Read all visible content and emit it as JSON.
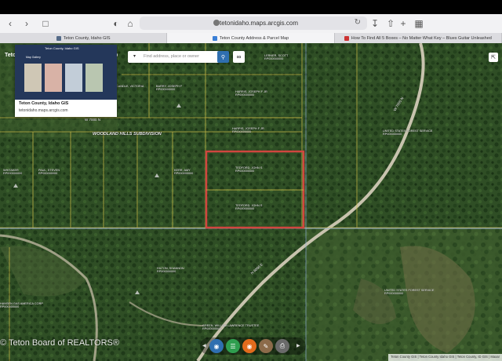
{
  "browser": {
    "url": "tetonidaho.maps.arcgis.com",
    "tabs": [
      {
        "label": "Teton County, Idaho GIS",
        "favicon_color": "#556b88"
      },
      {
        "label": "Teton County Address & Parcel Map",
        "favicon_color": "#3b7fd6"
      },
      {
        "label": "How To Find All 5 Boxes – No Matter What Key – Blues Guitar Unleashed",
        "favicon_color": "#c33"
      }
    ],
    "active_tab": 1
  },
  "app": {
    "title_left": "Teto",
    "title_right": "p"
  },
  "preview_card": {
    "title": "Teton County, Idaho GIS",
    "domain": "tetonidaho.maps.arcgis.com",
    "thumb_header": "Teton County, Idaho GIS",
    "thumb_subheader": "Map Gallery"
  },
  "search": {
    "placeholder": "Find address, place or owner",
    "dropdown": "▾"
  },
  "subdivision": "WOODLAND HILLS SUBDIVISION",
  "parcels": [
    {
      "name": "LERNER, SCOTT",
      "id": "RP000000000"
    },
    {
      "name": "CHRISTIAN, VICTORIA",
      "id": "RP000000000"
    },
    {
      "name": "BARRY, JOSEPH F",
      "id": "RP000000000"
    },
    {
      "name": "HARRIS, JOSEPH F JR",
      "id": "RP000000000"
    },
    {
      "name": "WHITAKER",
      "id": "RP000000000"
    },
    {
      "name": "CANDLE, VICTORIA",
      "id": "RP000000000"
    },
    {
      "name": "PAUL, STEVEN",
      "id": "RP000000000"
    },
    {
      "name": "KERR, AMY",
      "id": "RP000000000"
    },
    {
      "name": "TEDFORD, JOHN S",
      "id": "RP000000000"
    },
    {
      "name": "TEDFORD, JOHN S",
      "id": "RP000000000"
    },
    {
      "name": "UNITED STATES FOREST SERVICE",
      "id": "RP000000000"
    },
    {
      "name": "UNITED STATES FOREST SERVICE",
      "id": "RP000000000"
    },
    {
      "name": "HILTON, SHANNON",
      "id": "RP000000000"
    },
    {
      "name": "HANSEN GAS AMERICA CORP",
      "id": "RP000000000"
    },
    {
      "name": "GREEN, WILLIAM LAWRENCE TRUSTEE",
      "id": "RP000000000"
    }
  ],
  "road_labels": [
    "W 7000 N",
    "W 7000 N",
    "N 6000 E"
  ],
  "attribution": "Teton County GIS | Teton County Idaho GIS | Teton County, ID GIS | Maxar",
  "watermark": "© Teton Board of REALTORS®",
  "dock_colors": [
    "#2f6fb0",
    "#2f9e4f",
    "#e26b1d",
    "#8c6b4a",
    "#6a6a6a"
  ]
}
